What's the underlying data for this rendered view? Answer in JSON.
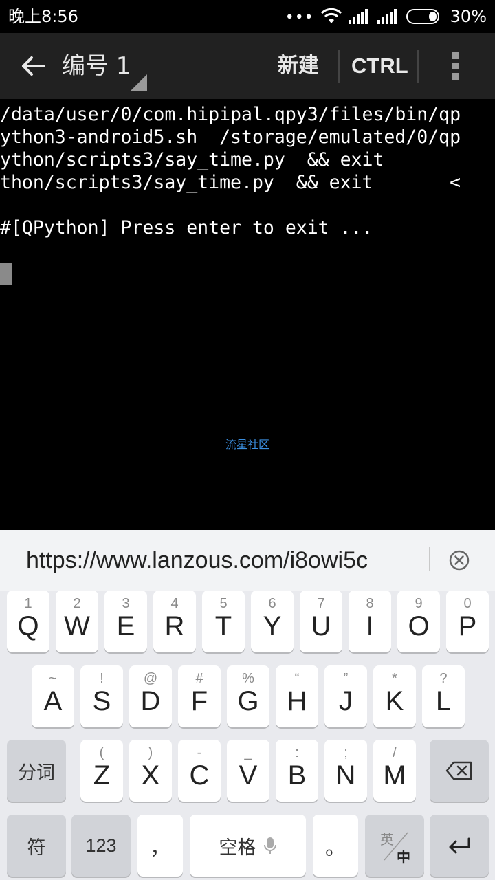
{
  "status_bar": {
    "time": "晚上8:56",
    "dots": "•••",
    "battery": "30%"
  },
  "toolbar": {
    "title": "编号 1",
    "new_label": "新建",
    "ctrl_label": "CTRL"
  },
  "terminal": {
    "lines": [
      "/data/user/0/com.hipipal.qpy3/files/bin/qp",
      "ython3-android5.sh  /storage/emulated/0/qp",
      "ython/scripts3/say_time.py  && exit",
      "thon/scripts3/say_time.py  && exit       <",
      "",
      "#[QPython] Press enter to exit ..."
    ],
    "watermark": "流星社区"
  },
  "keyboard": {
    "clipboard_text": "https://www.lanzous.com/i8owi5c",
    "row1": [
      {
        "hint": "1",
        "key": "Q"
      },
      {
        "hint": "2",
        "key": "W"
      },
      {
        "hint": "3",
        "key": "E"
      },
      {
        "hint": "4",
        "key": "R"
      },
      {
        "hint": "5",
        "key": "T"
      },
      {
        "hint": "6",
        "key": "Y"
      },
      {
        "hint": "7",
        "key": "U"
      },
      {
        "hint": "8",
        "key": "I"
      },
      {
        "hint": "9",
        "key": "O"
      },
      {
        "hint": "0",
        "key": "P"
      }
    ],
    "row2": [
      {
        "hint": "~",
        "key": "A"
      },
      {
        "hint": "!",
        "key": "S"
      },
      {
        "hint": "@",
        "key": "D"
      },
      {
        "hint": "#",
        "key": "F"
      },
      {
        "hint": "%",
        "key": "G"
      },
      {
        "hint": "“",
        "key": "H"
      },
      {
        "hint": "”",
        "key": "J"
      },
      {
        "hint": "*",
        "key": "K"
      },
      {
        "hint": "?",
        "key": "L"
      }
    ],
    "row3": [
      {
        "hint": "(",
        "key": "Z"
      },
      {
        "hint": ")",
        "key": "X"
      },
      {
        "hint": "-",
        "key": "C"
      },
      {
        "hint": "_",
        "key": "V"
      },
      {
        "hint": ":",
        "key": "B"
      },
      {
        "hint": ";",
        "key": "N"
      },
      {
        "hint": "/",
        "key": "M"
      }
    ],
    "segment_label": "分词",
    "symbol_label": "符",
    "num_label": "123",
    "comma_label": "，",
    "space_label": "空格",
    "period_label": "。",
    "lang_top": "英",
    "lang_bottom": "中"
  }
}
